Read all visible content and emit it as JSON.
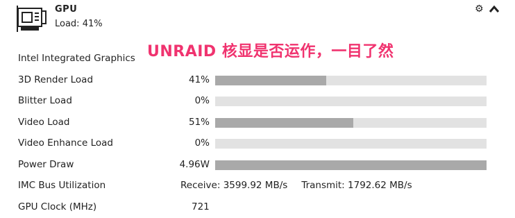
{
  "header": {
    "title": "GPU",
    "subtitle": "Load: 41%",
    "icons": {
      "device": "graphics-card-icon",
      "settings": "gear-icon",
      "collapse": "chevron-up-icon"
    }
  },
  "banner": "UNRAID 核显是否运作，一目了然",
  "section_title": "Intel Integrated Graphics",
  "metrics": [
    {
      "label": "3D Render Load",
      "value": "41%",
      "fill": 0.41
    },
    {
      "label": "Blitter Load",
      "value": "0%",
      "fill": 0.0
    },
    {
      "label": "Video Load",
      "value": "51%",
      "fill": 0.51
    },
    {
      "label": "Video Enhance Load",
      "value": "0%",
      "fill": 0.0
    },
    {
      "label": "Power Draw",
      "value": "4.96W",
      "fill": 1.0
    }
  ],
  "imc": {
    "label": "IMC Bus Utilization",
    "receive": "Receive: 3599.92 MB/s",
    "transmit": "Transmit: 1792.62 MB/s"
  },
  "clock": {
    "label": "GPU Clock (MHz)",
    "value": "721"
  },
  "colors": {
    "bar_track": "#e2e2e2",
    "bar_fill": "#a9a9a9",
    "banner": "#f0336f"
  }
}
